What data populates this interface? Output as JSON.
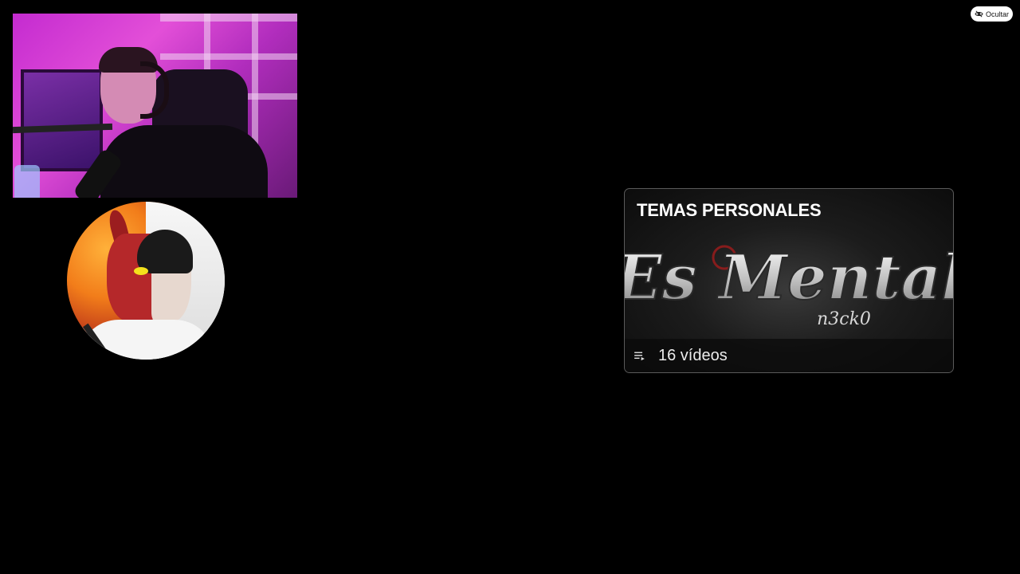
{
  "overlay": {
    "hide_button_label": "Ocultar"
  },
  "playlist": {
    "title": "TEMAS PERSONALES",
    "logo_text": "Es Mental",
    "logo_subtext": "n3ck0",
    "video_count_label": "16 vídeos"
  },
  "icons": {
    "hide": "eye-off-icon",
    "playlist": "playlist-icon"
  },
  "colors": {
    "background": "#000000",
    "pill_background": "#ffffff",
    "card_border": "#5a5a5a"
  }
}
